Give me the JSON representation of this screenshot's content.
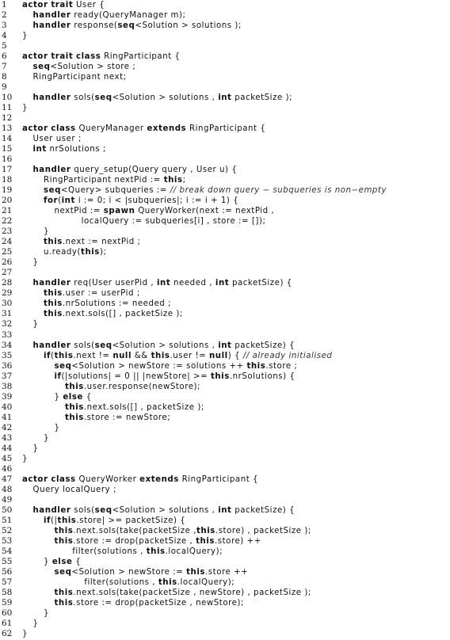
{
  "document": {
    "type": "code-listing",
    "language": "actor pseudo-code",
    "lines": [
      {
        "n": "1",
        "indent": 0,
        "t": [
          [
            "kw",
            "actor"
          ],
          [
            "",
            "  "
          ],
          [
            "kw",
            "trait"
          ],
          [
            "",
            "  User  {"
          ]
        ]
      },
      {
        "n": "2",
        "indent": 1,
        "t": [
          [
            "kw",
            "handler"
          ],
          [
            "",
            "  ready(QueryManager m);"
          ]
        ]
      },
      {
        "n": "3",
        "indent": 1,
        "t": [
          [
            "kw",
            "handler"
          ],
          [
            "",
            "  response("
          ],
          [
            "kw",
            "seq"
          ],
          [
            "",
            "<Solution >  solutions );"
          ]
        ]
      },
      {
        "n": "4",
        "indent": 0,
        "t": [
          [
            "",
            "}"
          ]
        ]
      },
      {
        "n": "5",
        "indent": 0,
        "t": []
      },
      {
        "n": "6",
        "indent": 0,
        "t": [
          [
            "kw",
            "actor"
          ],
          [
            "",
            "  "
          ],
          [
            "kw",
            "trait"
          ],
          [
            "",
            "  "
          ],
          [
            "kw",
            "class"
          ],
          [
            "",
            "  RingParticipant  {"
          ]
        ]
      },
      {
        "n": "7",
        "indent": 1,
        "t": [
          [
            "kw",
            "seq"
          ],
          [
            "",
            "<Solution >  store ;"
          ]
        ]
      },
      {
        "n": "8",
        "indent": 1,
        "t": [
          [
            "",
            "RingParticipant  next;"
          ]
        ]
      },
      {
        "n": "9",
        "indent": 0,
        "t": []
      },
      {
        "n": "10",
        "indent": 1,
        "t": [
          [
            "kw",
            "handler"
          ],
          [
            "",
            "  sols("
          ],
          [
            "kw",
            "seq"
          ],
          [
            "",
            "<Solution >  solutions ,  "
          ],
          [
            "kw",
            "int"
          ],
          [
            "",
            "  packetSize );"
          ]
        ]
      },
      {
        "n": "11",
        "indent": 0,
        "t": [
          [
            "",
            "}"
          ]
        ]
      },
      {
        "n": "12",
        "indent": 0,
        "t": []
      },
      {
        "n": "13",
        "indent": 0,
        "t": [
          [
            "kw",
            "actor"
          ],
          [
            "",
            "  "
          ],
          [
            "kw",
            "class"
          ],
          [
            "",
            "  QueryManager  "
          ],
          [
            "kw",
            "extends"
          ],
          [
            "",
            "  RingParticipant  {"
          ]
        ]
      },
      {
        "n": "14",
        "indent": 1,
        "t": [
          [
            "",
            "User  user ;"
          ]
        ]
      },
      {
        "n": "15",
        "indent": 1,
        "t": [
          [
            "kw",
            "int"
          ],
          [
            "",
            "  nrSolutions ;"
          ]
        ]
      },
      {
        "n": "16",
        "indent": 0,
        "t": []
      },
      {
        "n": "17",
        "indent": 1,
        "t": [
          [
            "kw",
            "handler"
          ],
          [
            "",
            "  query_setup(Query  query ,  User  u)  {"
          ]
        ]
      },
      {
        "n": "18",
        "indent": 2,
        "t": [
          [
            "",
            "RingParticipant  nextPid  :=  "
          ],
          [
            "kw",
            "this"
          ],
          [
            "",
            ";"
          ]
        ]
      },
      {
        "n": "19",
        "indent": 2,
        "t": [
          [
            "kw",
            "seq"
          ],
          [
            "",
            "<Query>  subqueries  :=  "
          ],
          [
            "cm",
            "//  break  down  query  −  subqueries  is  non−empty"
          ]
        ]
      },
      {
        "n": "20",
        "indent": 2,
        "t": [
          [
            "kw",
            "for"
          ],
          [
            "",
            "("
          ],
          [
            "kw",
            "int"
          ],
          [
            "",
            "  i  :=  0;  i  <  |subqueries|;  i  :=  i  +  1)  {"
          ]
        ]
      },
      {
        "n": "21",
        "indent": 3,
        "t": [
          [
            "",
            "nextPid  :=  "
          ],
          [
            "kw",
            "spawn"
          ],
          [
            "",
            "  QueryWorker(next  :=  nextPid ,"
          ]
        ]
      },
      {
        "n": "22",
        "indent": 3,
        "t": [
          [
            "",
            "                                    localQuery  :=  subqueries[i] ,  store  :=  []);"
          ]
        ]
      },
      {
        "n": "23",
        "indent": 2,
        "t": [
          [
            "",
            "}"
          ]
        ]
      },
      {
        "n": "24",
        "indent": 2,
        "t": [
          [
            "kw",
            "this"
          ],
          [
            "",
            ".next  :=  nextPid ;"
          ]
        ]
      },
      {
        "n": "25",
        "indent": 2,
        "t": [
          [
            "",
            "u.ready("
          ],
          [
            "kw",
            "this"
          ],
          [
            "",
            ");"
          ]
        ]
      },
      {
        "n": "26",
        "indent": 1,
        "t": [
          [
            "",
            "}"
          ]
        ]
      },
      {
        "n": "27",
        "indent": 0,
        "t": []
      },
      {
        "n": "28",
        "indent": 1,
        "t": [
          [
            "kw",
            "handler"
          ],
          [
            "",
            "  req(User  userPid ,  "
          ],
          [
            "kw",
            "int"
          ],
          [
            "",
            "  needed ,  "
          ],
          [
            "kw",
            "int"
          ],
          [
            "",
            "  packetSize)  {"
          ]
        ]
      },
      {
        "n": "29",
        "indent": 2,
        "t": [
          [
            "kw",
            "this"
          ],
          [
            "",
            ".user  :=  userPid ;"
          ]
        ]
      },
      {
        "n": "30",
        "indent": 2,
        "t": [
          [
            "kw",
            "this"
          ],
          [
            "",
            ".nrSolutions  :=  needed ;"
          ]
        ]
      },
      {
        "n": "31",
        "indent": 2,
        "t": [
          [
            "kw",
            "this"
          ],
          [
            "",
            ".next.sols([] ,  packetSize );"
          ]
        ]
      },
      {
        "n": "32",
        "indent": 1,
        "t": [
          [
            "",
            "}"
          ]
        ]
      },
      {
        "n": "33",
        "indent": 0,
        "t": []
      },
      {
        "n": "34",
        "indent": 1,
        "t": [
          [
            "kw",
            "handler"
          ],
          [
            "",
            "  sols("
          ],
          [
            "kw",
            "seq"
          ],
          [
            "",
            "<Solution >  solutions ,  "
          ],
          [
            "kw",
            "int"
          ],
          [
            "",
            "  packetSize)  {"
          ]
        ]
      },
      {
        "n": "35",
        "indent": 2,
        "t": [
          [
            "kw",
            "if"
          ],
          [
            "",
            "("
          ],
          [
            "kw",
            "this"
          ],
          [
            "",
            ".next  !=  "
          ],
          [
            "kw",
            "null"
          ],
          [
            "",
            "  &&  "
          ],
          [
            "kw",
            "this"
          ],
          [
            "",
            ".user  !=  "
          ],
          [
            "kw",
            "null"
          ],
          [
            "",
            ")  {  "
          ],
          [
            "cm",
            "//  already  initialised"
          ]
        ]
      },
      {
        "n": "36",
        "indent": 3,
        "t": [
          [
            "kw",
            "seq"
          ],
          [
            "",
            "<Solution >  newStore  :=  solutions  ++  "
          ],
          [
            "kw",
            "this"
          ],
          [
            "",
            ".store ;"
          ]
        ]
      },
      {
        "n": "37",
        "indent": 3,
        "t": [
          [
            "kw",
            "if"
          ],
          [
            "",
            "(|solutions|  =  0  ||  |newStore|  >=  "
          ],
          [
            "kw",
            "this"
          ],
          [
            "",
            ".nrSolutions)  {"
          ]
        ]
      },
      {
        "n": "38",
        "indent": 4,
        "t": [
          [
            "kw",
            "this"
          ],
          [
            "",
            ".user.response(newStore);"
          ]
        ]
      },
      {
        "n": "39",
        "indent": 3,
        "t": [
          [
            "",
            "}  "
          ],
          [
            "kw",
            "else"
          ],
          [
            "",
            "  {"
          ]
        ]
      },
      {
        "n": "40",
        "indent": 4,
        "t": [
          [
            "kw",
            "this"
          ],
          [
            "",
            ".next.sols([] ,  packetSize );"
          ]
        ]
      },
      {
        "n": "41",
        "indent": 4,
        "t": [
          [
            "kw",
            "this"
          ],
          [
            "",
            ".store  :=  newStore;"
          ]
        ]
      },
      {
        "n": "42",
        "indent": 3,
        "t": [
          [
            "",
            "}"
          ]
        ]
      },
      {
        "n": "43",
        "indent": 2,
        "t": [
          [
            "",
            "}"
          ]
        ]
      },
      {
        "n": "44",
        "indent": 1,
        "t": [
          [
            "",
            "}"
          ]
        ]
      },
      {
        "n": "45",
        "indent": 0,
        "t": [
          [
            "",
            "}"
          ]
        ]
      },
      {
        "n": "46",
        "indent": 0,
        "t": []
      },
      {
        "n": "47",
        "indent": 0,
        "t": [
          [
            "kw",
            "actor"
          ],
          [
            "",
            "  "
          ],
          [
            "kw",
            "class"
          ],
          [
            "",
            "  QueryWorker  "
          ],
          [
            "kw",
            "extends"
          ],
          [
            "",
            "  RingParticipant  {"
          ]
        ]
      },
      {
        "n": "48",
        "indent": 1,
        "t": [
          [
            "",
            "Query  localQuery ;"
          ]
        ]
      },
      {
        "n": "49",
        "indent": 0,
        "t": []
      },
      {
        "n": "50",
        "indent": 1,
        "t": [
          [
            "kw",
            "handler"
          ],
          [
            "",
            "  sols("
          ],
          [
            "kw",
            "seq"
          ],
          [
            "",
            "<Solution >  solutions ,  "
          ],
          [
            "kw",
            "int"
          ],
          [
            "",
            "  packetSize)  {"
          ]
        ]
      },
      {
        "n": "51",
        "indent": 2,
        "t": [
          [
            "kw",
            "if"
          ],
          [
            "",
            "(|"
          ],
          [
            "kw",
            "this"
          ],
          [
            "",
            ".store|  >=  packetSize)  {"
          ]
        ]
      },
      {
        "n": "52",
        "indent": 3,
        "t": [
          [
            "kw",
            "this"
          ],
          [
            "",
            ".next.sols(take(packetSize ,"
          ],
          [
            "kw",
            "this"
          ],
          [
            "",
            ".store) ,  packetSize );"
          ]
        ]
      },
      {
        "n": "53",
        "indent": 3,
        "t": [
          [
            "kw",
            "this"
          ],
          [
            "",
            ".store  :=  drop(packetSize ,  "
          ],
          [
            "kw",
            "this"
          ],
          [
            "",
            ".store)  ++"
          ]
        ]
      },
      {
        "n": "54",
        "indent": 3,
        "t": [
          [
            "",
            "                      filter(solutions ,  "
          ],
          [
            "kw",
            "this"
          ],
          [
            "",
            ".localQuery);"
          ]
        ]
      },
      {
        "n": "55",
        "indent": 2,
        "t": [
          [
            "",
            "}  "
          ],
          [
            "kw",
            "else"
          ],
          [
            "",
            "  {"
          ]
        ]
      },
      {
        "n": "56",
        "indent": 3,
        "t": [
          [
            "kw",
            "seq"
          ],
          [
            "",
            "<Solution >  newStore  :=  "
          ],
          [
            "kw",
            "this"
          ],
          [
            "",
            ".store  ++"
          ]
        ]
      },
      {
        "n": "57",
        "indent": 3,
        "t": [
          [
            "",
            "                                      filter(solutions ,  "
          ],
          [
            "kw",
            "this"
          ],
          [
            "",
            ".localQuery);"
          ]
        ]
      },
      {
        "n": "58",
        "indent": 3,
        "t": [
          [
            "kw",
            "this"
          ],
          [
            "",
            ".next.sols(take(packetSize ,  newStore) ,  packetSize );"
          ]
        ]
      },
      {
        "n": "59",
        "indent": 3,
        "t": [
          [
            "kw",
            "this"
          ],
          [
            "",
            ".store  :=  drop(packetSize ,  newStore);"
          ]
        ]
      },
      {
        "n": "60",
        "indent": 2,
        "t": [
          [
            "",
            "}"
          ]
        ]
      },
      {
        "n": "61",
        "indent": 1,
        "t": [
          [
            "",
            "}"
          ]
        ]
      },
      {
        "n": "62",
        "indent": 0,
        "t": [
          [
            "",
            "}"
          ]
        ]
      }
    ]
  }
}
